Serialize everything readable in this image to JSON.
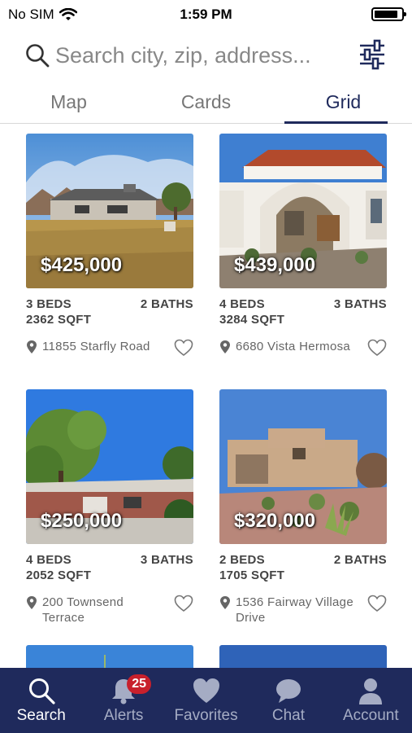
{
  "status_bar": {
    "carrier": "No SIM",
    "time": "1:59 PM"
  },
  "search": {
    "placeholder": "Search city, zip, address..."
  },
  "tabs": [
    {
      "label": "Map",
      "active": false
    },
    {
      "label": "Cards",
      "active": false
    },
    {
      "label": "Grid",
      "active": true
    }
  ],
  "listings": [
    {
      "price": "$425,000",
      "beds": "3 BEDS",
      "baths": "2 BATHS",
      "sqft": "2362 SQFT",
      "address": "11855 Starfly Road"
    },
    {
      "price": "$439,000",
      "beds": "4 BEDS",
      "baths": "3 BATHS",
      "sqft": "3284 SQFT",
      "address": "6680 Vista Hermosa"
    },
    {
      "price": "$250,000",
      "beds": "4 BEDS",
      "baths": "3 BATHS",
      "sqft": "2052 SQFT",
      "address": "200 Townsend Terrace"
    },
    {
      "price": "$320,000",
      "beds": "2 BEDS",
      "baths": "2 BATHS",
      "sqft": "1705 SQFT",
      "address": "1536 Fairway Village Drive"
    }
  ],
  "bottom_nav": {
    "items": [
      {
        "label": "Search",
        "icon": "search-icon",
        "active": true
      },
      {
        "label": "Alerts",
        "icon": "bell-icon",
        "badge": "25"
      },
      {
        "label": "Favorites",
        "icon": "heart-icon"
      },
      {
        "label": "Chat",
        "icon": "chat-bubble-icon"
      },
      {
        "label": "Account",
        "icon": "person-icon"
      }
    ]
  },
  "colors": {
    "primary": "#1f2a5c",
    "badge": "#c8202c",
    "active_nav": "#ffffff",
    "inactive_nav": "#a5acc4"
  }
}
